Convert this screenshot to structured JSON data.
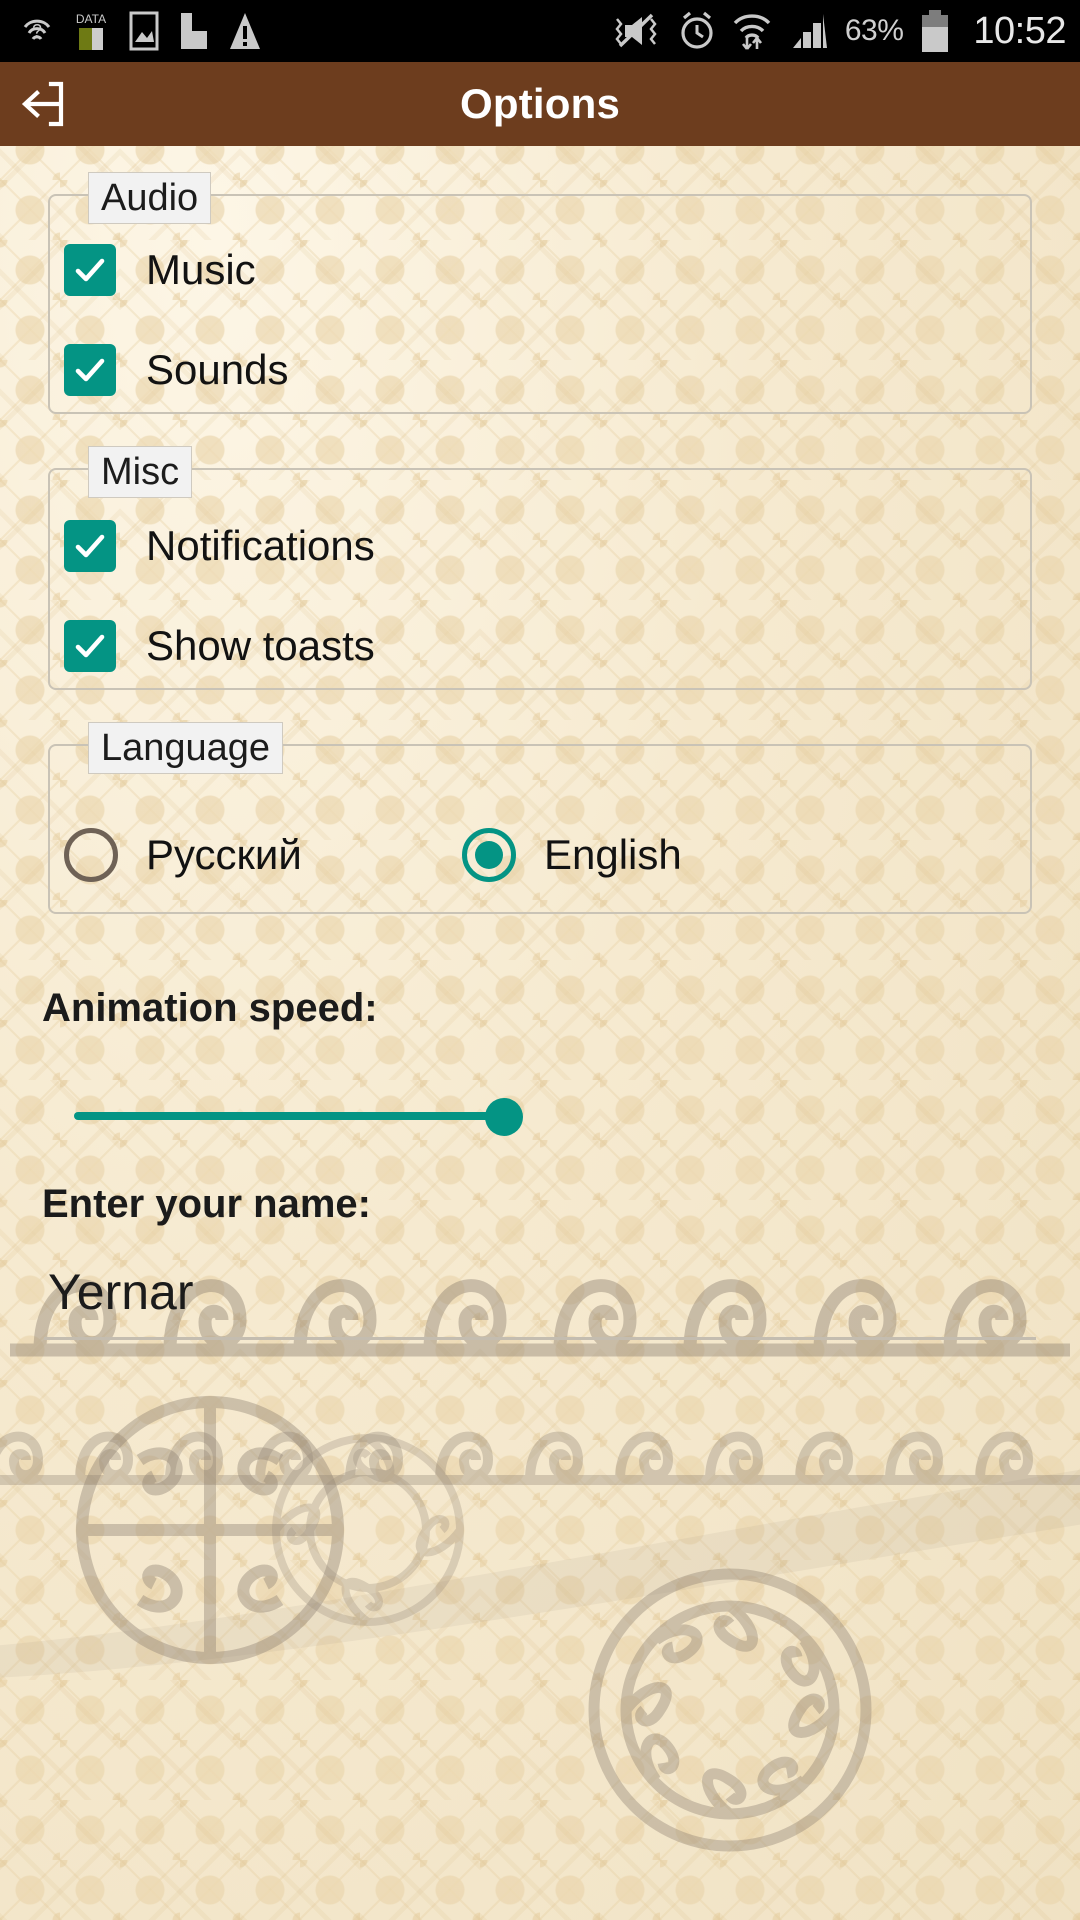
{
  "status_bar": {
    "icons_left": [
      "location-searching-icon",
      "data-usage-icon",
      "screenshot-image-icon",
      "flipboard-icon",
      "warning-triangle-icon"
    ],
    "icons_right": [
      "volume-mute-vibrate-icon",
      "alarm-clock-icon",
      "wifi-data-transfer-icon",
      "cellular-signal-icon"
    ],
    "battery_percent": "63%",
    "battery_icon": "battery-icon",
    "clock": "10:52"
  },
  "action_bar": {
    "back_icon": "back-exit-arrow-icon",
    "title": "Options"
  },
  "groups": {
    "audio": {
      "label": "Audio",
      "items": [
        {
          "label": "Music",
          "checked": true,
          "icon": "checkmark-icon"
        },
        {
          "label": "Sounds",
          "checked": true,
          "icon": "checkmark-icon"
        }
      ]
    },
    "misc": {
      "label": "Misc",
      "items": [
        {
          "label": "Notifications",
          "checked": true,
          "icon": "checkmark-icon"
        },
        {
          "label": "Show toasts",
          "checked": true,
          "icon": "checkmark-icon"
        }
      ]
    },
    "language": {
      "label": "Language",
      "options": [
        {
          "label": "Русский",
          "selected": false
        },
        {
          "label": "English",
          "selected": true
        }
      ]
    }
  },
  "animation_speed": {
    "label": "Animation speed:",
    "value_percent": 50,
    "min": 0,
    "max": 100
  },
  "name_field": {
    "label": "Enter your name:",
    "value": "Yernar",
    "placeholder": ""
  },
  "colors": {
    "action_bar": "#6d3d1e",
    "accent_teal": "#049484",
    "background_beige": "#f3e9d2",
    "status_bar": "#000000",
    "group_border": "#c9c3b6",
    "radio_unselected": "#6f6256"
  }
}
